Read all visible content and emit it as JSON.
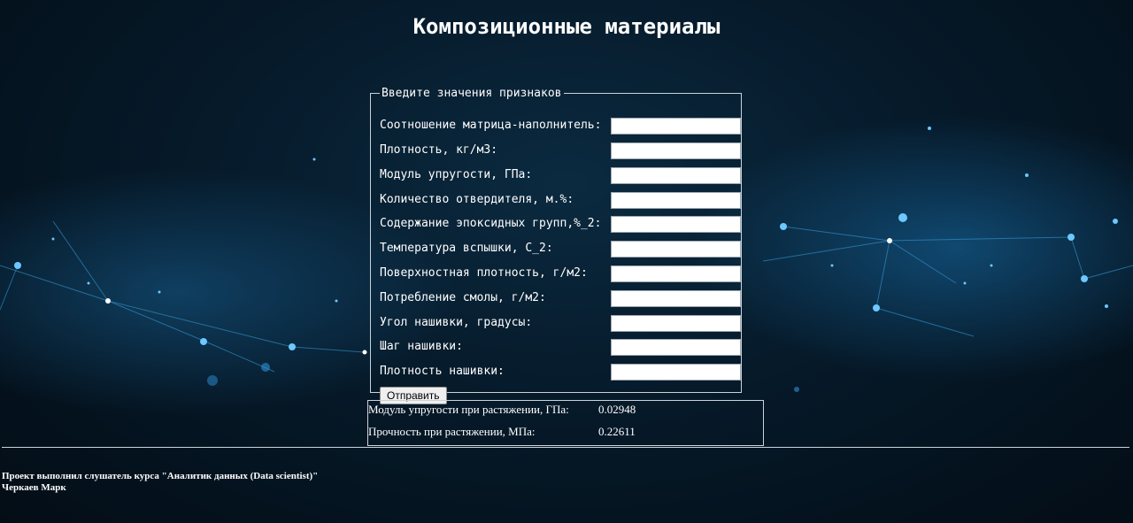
{
  "page_title": "Композиционные материалы",
  "form": {
    "legend": "Введите значения признаков",
    "fields": [
      {
        "label": "Соотношение матрица-наполнитель:",
        "value": ""
      },
      {
        "label": "Плотность, кг/м3:",
        "value": ""
      },
      {
        "label": "Модуль упругости, ГПа:",
        "value": ""
      },
      {
        "label": "Количество отвердителя, м.%:",
        "value": ""
      },
      {
        "label": "Содержание эпоксидных групп,%_2:",
        "value": ""
      },
      {
        "label": "Температура вспышки, С_2:",
        "value": ""
      },
      {
        "label": "Поверхностная плотность, г/м2:",
        "value": ""
      },
      {
        "label": "Потребление смолы, г/м2:",
        "value": ""
      },
      {
        "label": "Угол нашивки, градусы:",
        "value": ""
      },
      {
        "label": "Шаг нашивки:",
        "value": ""
      },
      {
        "label": "Плотность нашивки:",
        "value": ""
      }
    ],
    "submit_label": "Отправить"
  },
  "results": [
    {
      "label": "Модуль упругости при растяжении, ГПа:",
      "value": "0.02948"
    },
    {
      "label": "Прочность при растяжении, МПа:",
      "value": "0.22611"
    }
  ],
  "footer": {
    "line1": "Проект выполнил слушатель курса \"Аналитик данных (Data scientist)\"",
    "line2": "Черкаев Марк"
  },
  "colors": {
    "background": "#061a2a",
    "network_glow": "#2fa8ff",
    "border": "#c9d3da"
  }
}
